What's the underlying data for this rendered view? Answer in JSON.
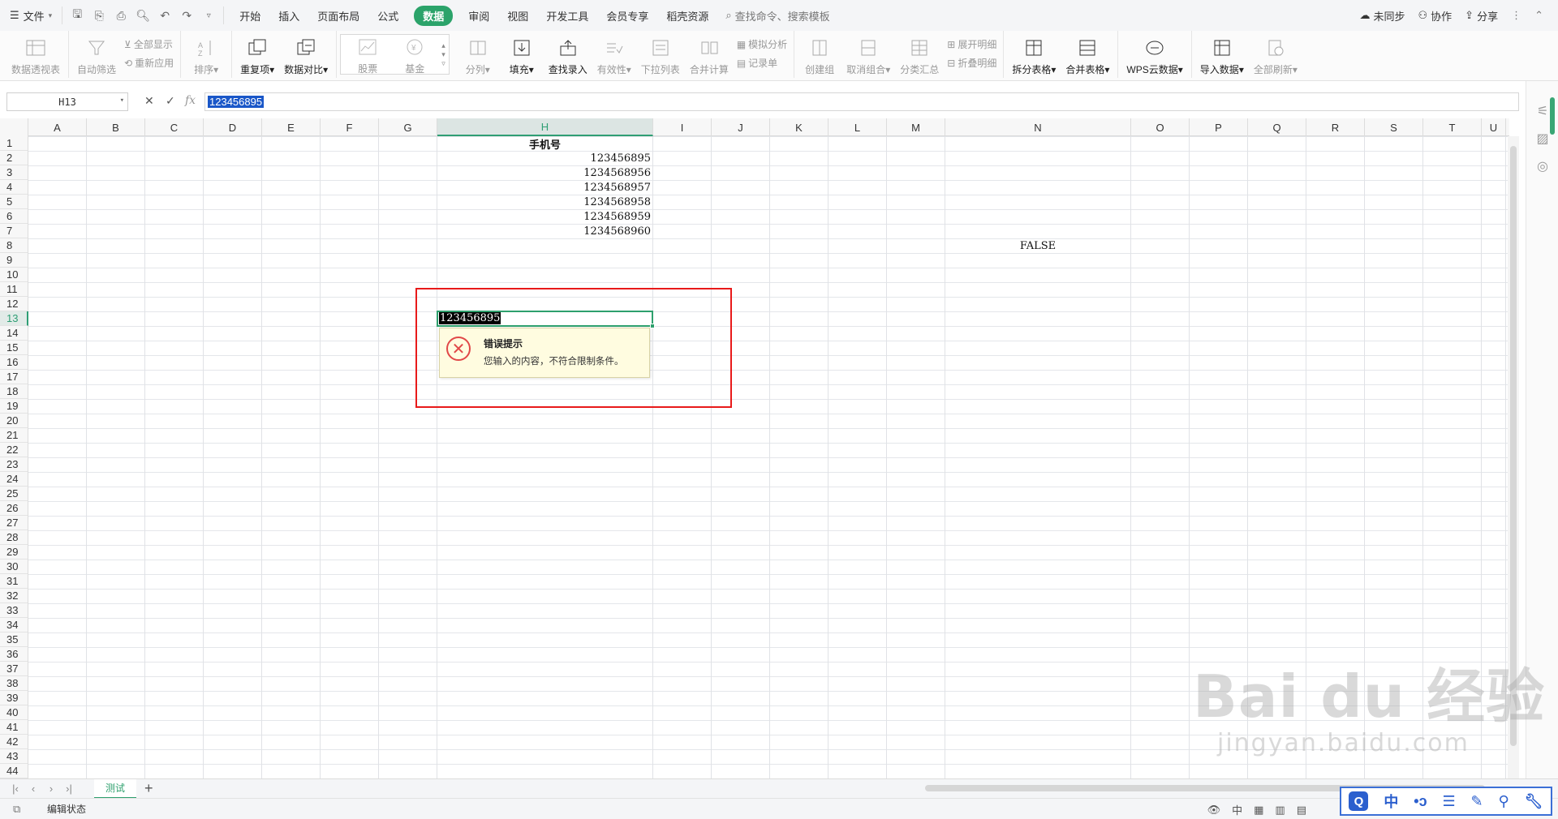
{
  "menu": {
    "file": "文件",
    "tabs": [
      "开始",
      "插入",
      "页面布局",
      "公式",
      "数据",
      "审阅",
      "视图",
      "开发工具",
      "会员专享",
      "稻壳资源"
    ],
    "active_tab": "数据",
    "search": "查找命令、搜索模板",
    "sync": "未同步",
    "collab": "协作",
    "share": "分享"
  },
  "ribbon": {
    "pivot": "数据透视表",
    "autofilter": "自动筛选",
    "show_all": "全部显示",
    "reapply": "重新应用",
    "sort": "排序",
    "duplicates": "重复项",
    "compare": "数据对比",
    "stock": "股票",
    "fund": "基金",
    "split": "分列",
    "fill": "填充",
    "lookup": "查找录入",
    "validity": "有效性",
    "dropdown": "下拉列表",
    "consolidate": "合并计算",
    "whatif": "模拟分析",
    "record": "记录单",
    "group": "创建组",
    "ungroup": "取消组合",
    "subtotal": "分类汇总",
    "expand": "展开明细",
    "collapse": "折叠明细",
    "split_table": "拆分表格",
    "merge_table": "合并表格",
    "wps_cloud": "WPS云数据",
    "import": "导入数据",
    "refresh_all": "全部刷新"
  },
  "formula_bar": {
    "name_box": "H13",
    "fx": "fx",
    "value": "123456895"
  },
  "columns": [
    "A",
    "B",
    "C",
    "D",
    "E",
    "F",
    "G",
    "H",
    "I",
    "J",
    "K",
    "L",
    "M",
    "N",
    "O",
    "P",
    "Q",
    "R",
    "S",
    "T",
    "U"
  ],
  "active_column": "H",
  "active_row": 13,
  "rows": [
    1,
    2,
    3,
    4,
    5,
    6,
    7,
    8,
    9,
    10,
    11,
    12,
    13,
    14,
    15,
    16,
    17,
    18,
    19,
    20,
    21,
    22,
    23,
    24,
    25,
    26,
    27,
    28,
    29,
    30,
    31,
    32,
    33,
    34,
    35,
    36,
    37,
    38,
    39,
    40,
    41,
    42,
    43,
    44
  ],
  "cells": {
    "H1": "手机号",
    "H2": "123456895",
    "H3": "1234568956",
    "H4": "1234568957",
    "H5": "1234568958",
    "H6": "1234568959",
    "H7": "1234568960",
    "N8": "FALSE",
    "H13": "123456895"
  },
  "error_tip": {
    "title": "错误提示",
    "message": "您输入的内容，不符合限制条件。"
  },
  "sheet_tab": "测试",
  "status": "编辑状态",
  "watermark": {
    "brand": "Bai du 经验",
    "url": "jingyan.baidu.com"
  },
  "ime": {
    "lang": "中"
  }
}
